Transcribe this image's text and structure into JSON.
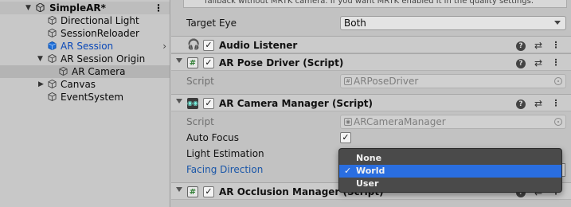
{
  "hierarchy": {
    "scene": "SimpleAR*",
    "items": [
      {
        "label": "Directional Light"
      },
      {
        "label": "SessionReloader"
      },
      {
        "label": "AR Session"
      },
      {
        "label": "AR Session Origin"
      },
      {
        "label": "AR Camera"
      },
      {
        "label": "Canvas"
      },
      {
        "label": "EventSystem"
      }
    ]
  },
  "inspector": {
    "help_text": "fallback without MRTK camera. If you want MRTK enabled it in the quality settings.",
    "target_eye": {
      "label": "Target Eye",
      "value": "Both"
    },
    "audio_listener": {
      "title": "Audio Listener"
    },
    "pose_driver": {
      "title": "AR Pose Driver (Script)",
      "script_label": "Script",
      "script_value": "ARPoseDriver"
    },
    "camera_manager": {
      "title": "AR Camera Manager (Script)",
      "script_label": "Script",
      "script_value": "ARCameraManager",
      "auto_focus_label": "Auto Focus",
      "light_estimation_label": "Light Estimation",
      "facing_direction_label": "Facing Direction"
    },
    "occlusion_manager": {
      "title": "AR Occlusion Manager (Script)"
    }
  },
  "popup": {
    "options": [
      "None",
      "World",
      "User"
    ],
    "selected": "World"
  },
  "colors": {
    "selection_blue": "#2a6ee0",
    "link_blue": "#1a56a8",
    "popup_bg": "#4a4a4a"
  }
}
